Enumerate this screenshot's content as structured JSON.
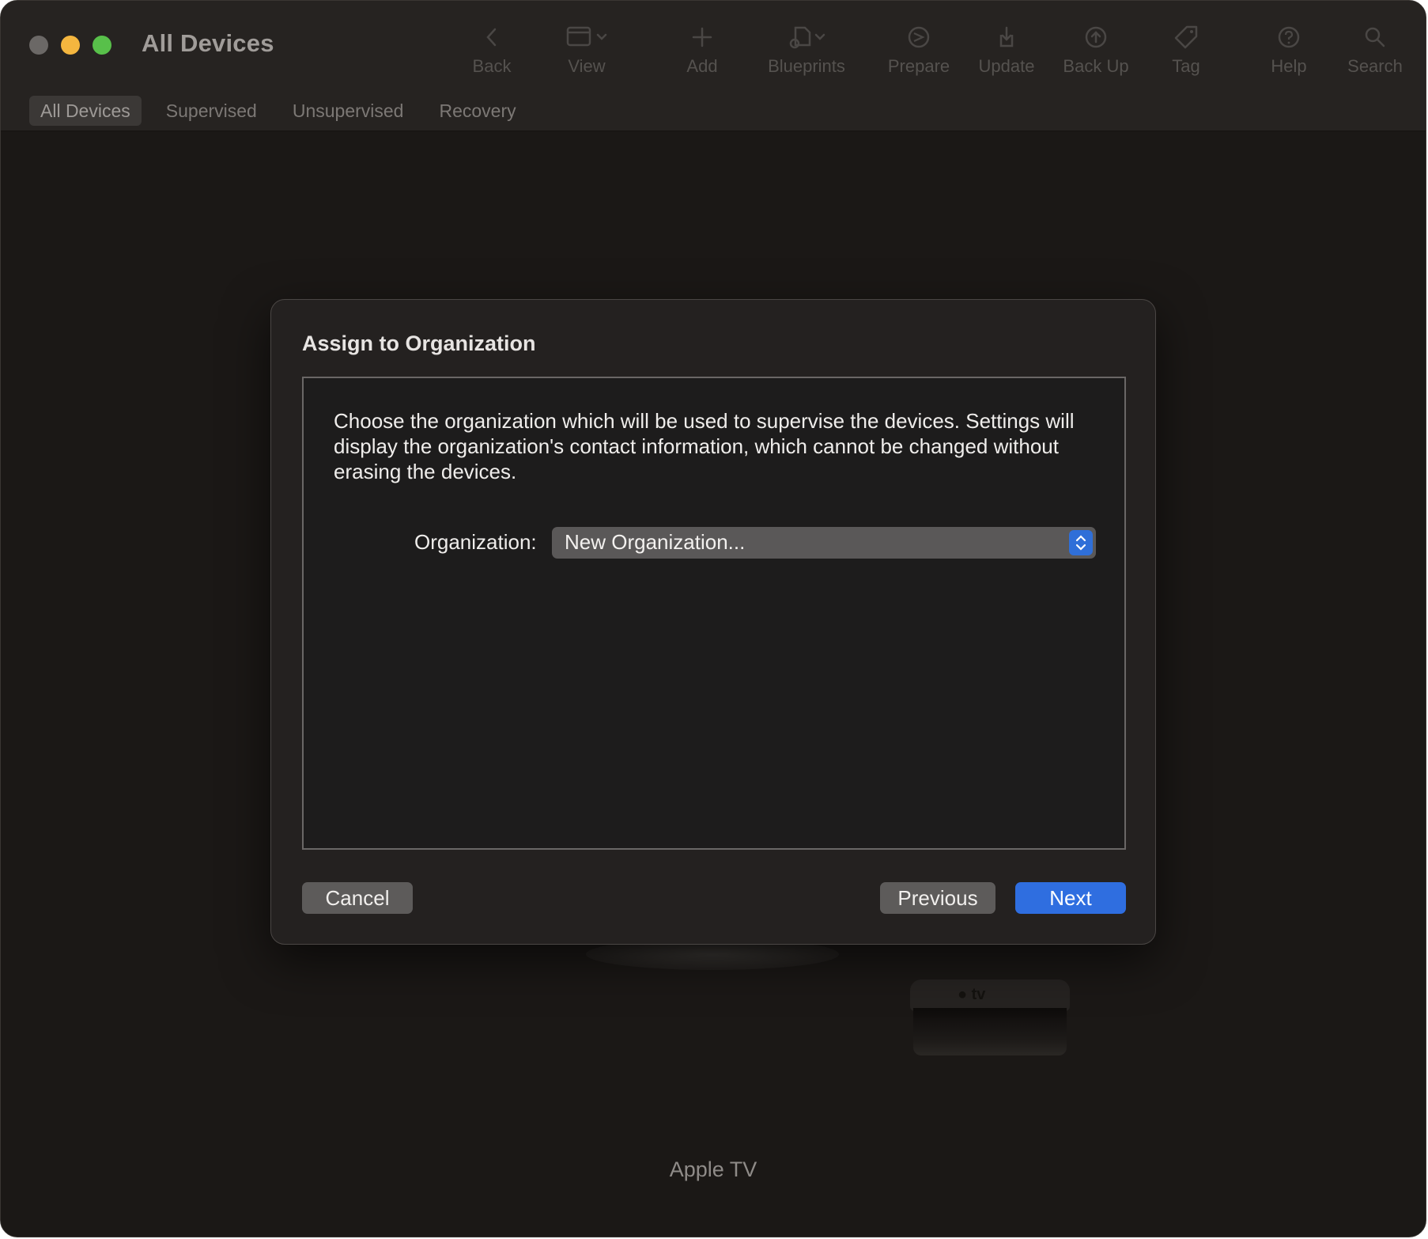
{
  "window": {
    "title": "All Devices"
  },
  "toolbar": {
    "items": [
      {
        "label": "Back",
        "icon": "chevron-left-icon"
      },
      {
        "label": "View",
        "icon": "window-icon"
      },
      {
        "label": "Add",
        "icon": "plus-icon"
      },
      {
        "label": "Blueprints",
        "icon": "blueprints-icon"
      },
      {
        "label": "Prepare",
        "icon": "prepare-icon"
      },
      {
        "label": "Update",
        "icon": "update-icon"
      },
      {
        "label": "Back Up",
        "icon": "backup-icon"
      },
      {
        "label": "Tag",
        "icon": "tag-icon"
      },
      {
        "label": "Help",
        "icon": "help-icon"
      },
      {
        "label": "Search",
        "icon": "search-icon"
      }
    ]
  },
  "tabs": [
    {
      "label": "All Devices",
      "active": true
    },
    {
      "label": "Supervised",
      "active": false
    },
    {
      "label": "Unsupervised",
      "active": false
    },
    {
      "label": "Recovery",
      "active": false
    }
  ],
  "device": {
    "name": "Apple TV",
    "logo": "tv"
  },
  "dialog": {
    "title": "Assign to Organization",
    "description": "Choose the organization which will be used to supervise the devices. Settings will display the organization's contact information, which cannot be changed without erasing the devices.",
    "organization_label": "Organization:",
    "organization_value": "New Organization...",
    "cancel_label": "Cancel",
    "previous_label": "Previous",
    "next_label": "Next"
  },
  "colors": {
    "accent": "#2f6ee0",
    "close": "#6b6866",
    "minimize": "#f4b63f",
    "zoom": "#58c04a"
  }
}
